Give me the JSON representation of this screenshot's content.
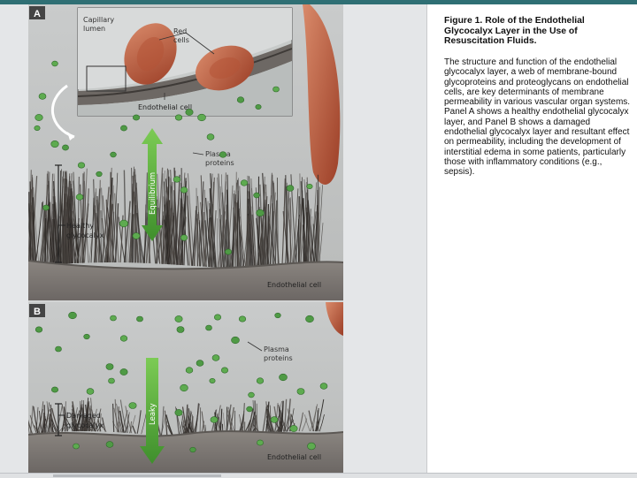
{
  "figure": {
    "panel_a": {
      "letter": "A",
      "inset_capillary_lumen": [
        "Capillary",
        "lumen"
      ],
      "inset_rbc": [
        "Red",
        "cells"
      ],
      "inset_endothelial": "Endothelial cell",
      "plasma_proteins": [
        "Plasma",
        "proteins"
      ],
      "arrow_label": "Equilibrium",
      "glycocalyx_label": [
        "Healthy",
        "glycocalyx"
      ],
      "endothelial_label": "Endothelial cell"
    },
    "panel_b": {
      "letter": "B",
      "plasma_proteins": [
        "Plasma",
        "proteins"
      ],
      "arrow_label": "Leaky",
      "glycocalyx_label": [
        "Damaged",
        "glycocalyx"
      ],
      "endothelial_label": "Endothelial cell"
    }
  },
  "caption": {
    "title": "Figure 1. Role of the Endothelial Glycocalyx Layer in the Use of Resuscitation Fluids.",
    "body": "The structure and function of the endothelial glycocalyx layer, a web of membrane-bound glycoproteins and proteoglycans on endothelial cells, are key determinants of membrane permeability in various vascular organ systems. Panel A shows a healthy endothelial glycocalyx layer, and Panel B shows a damaged endothelial glycocalyx layer and resultant effect on permeability, including the development of interstitial edema in some patients, particularly those with inflammatory conditions (e.g., sepsis)."
  },
  "colors": {
    "protein_green": "#4f9a45",
    "arrow_green": "#5cb23e",
    "rbc": "#b85a3c",
    "cell_gray": "#7b7672",
    "background": "#d2d4d4"
  }
}
